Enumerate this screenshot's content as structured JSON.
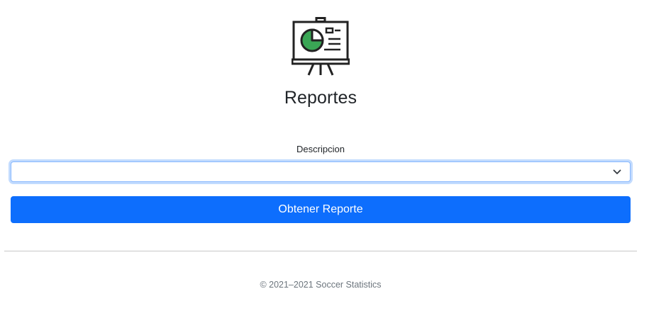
{
  "header": {
    "logo_icon": "presentation-board-pie-chart-icon",
    "title": "Reportes"
  },
  "form": {
    "description_label": "Descripcion",
    "description_select": {
      "selected_value": "",
      "icon": "chevron-down-icon"
    },
    "submit_label": "Obtener Reporte"
  },
  "footer": {
    "copyright": "© 2021–2021 Soccer Statistics"
  },
  "colors": {
    "primary": "#0d6efd",
    "focus_border": "#86b7fe",
    "chart_green": "#3aa655",
    "text": "#212529",
    "muted": "#6c757d"
  }
}
